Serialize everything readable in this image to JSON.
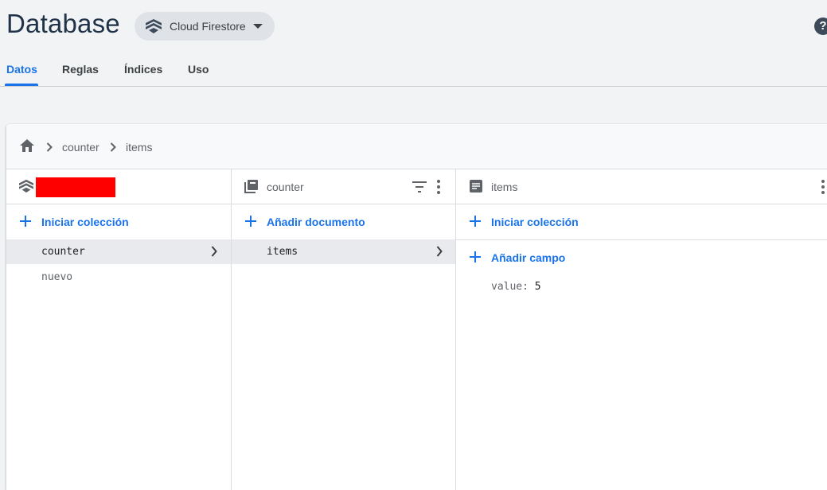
{
  "header": {
    "title": "Database",
    "product_selector": {
      "label": "Cloud Firestore",
      "icon": "firestore-icon"
    },
    "help_icon": "help-icon",
    "tabs": [
      {
        "label": "Datos",
        "active": true
      },
      {
        "label": "Reglas",
        "active": false
      },
      {
        "label": "Índices",
        "active": false
      },
      {
        "label": "Uso",
        "active": false
      }
    ]
  },
  "breadcrumb": {
    "home_icon": "home-icon",
    "items": [
      "counter",
      "items"
    ]
  },
  "columns": {
    "root": {
      "header_icon": "firestore-icon",
      "project_name_redacted": true,
      "action_label": "Iniciar colección",
      "items": [
        {
          "label": "counter",
          "selected": true
        },
        {
          "label": "nuevo",
          "selected": false
        }
      ]
    },
    "collection": {
      "header_icon": "collection-icon",
      "header_label": "counter",
      "action_label": "Añadir documento",
      "items": [
        {
          "label": "items",
          "selected": true
        }
      ]
    },
    "document": {
      "header_icon": "document-icon",
      "header_label": "items",
      "collection_action_label": "Iniciar colección",
      "field_action_label": "Añadir campo",
      "fields": [
        {
          "key": "value:",
          "value": "5"
        }
      ]
    }
  },
  "colors": {
    "accent": "#1a73e8",
    "title": "#1f3247",
    "background": "#f1f3f4"
  }
}
